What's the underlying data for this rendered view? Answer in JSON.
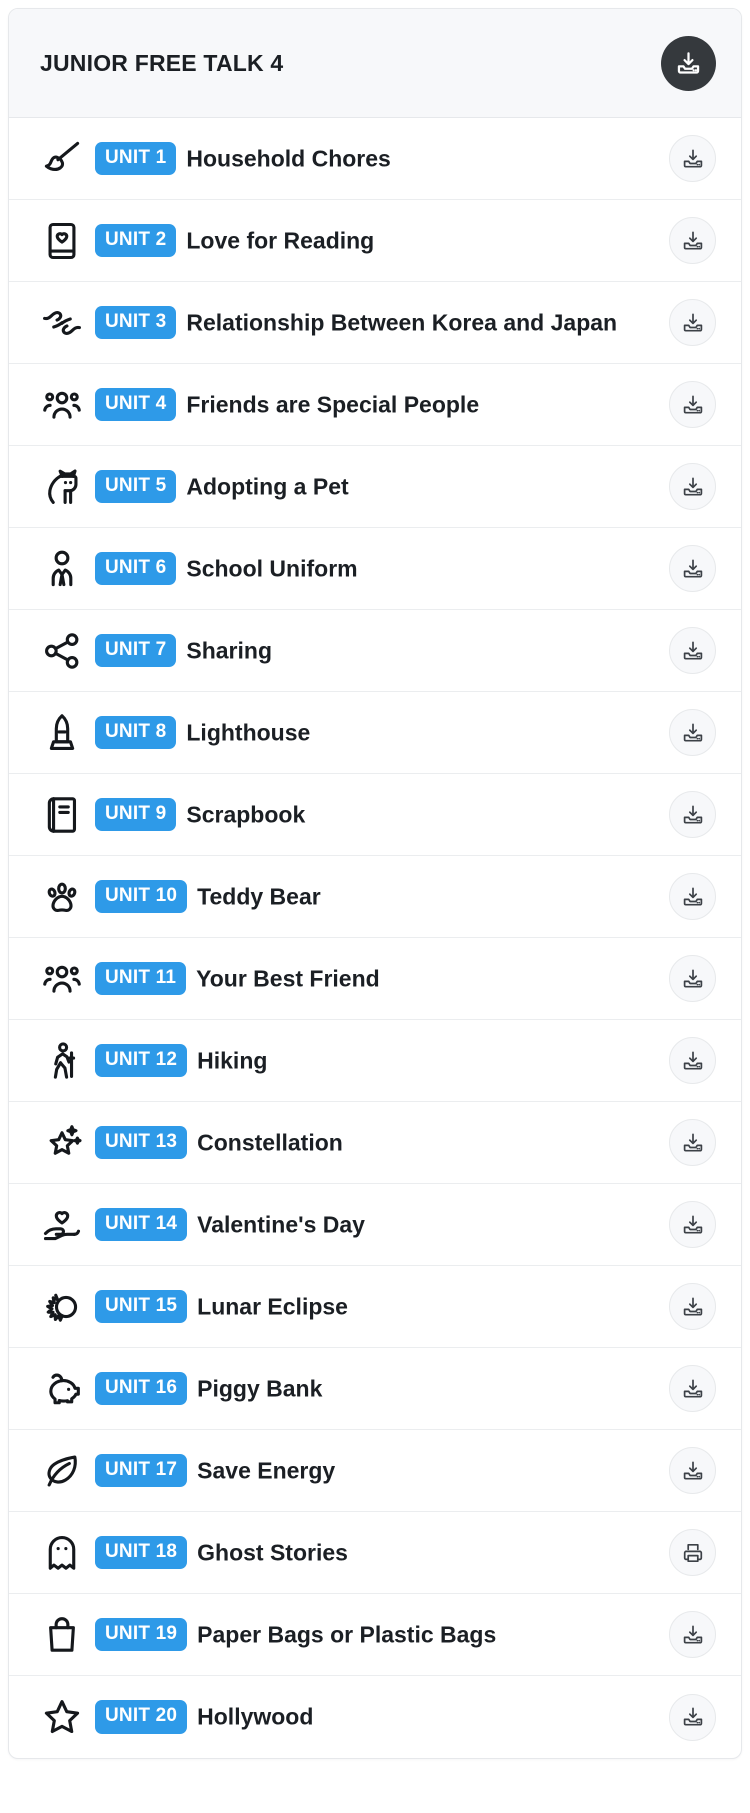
{
  "header": {
    "title": "JUNIOR FREE TALK 4",
    "download_all_icon": "download-icon"
  },
  "colors": {
    "badge_blue": "#2e9ae8",
    "header_bg": "#f7f8fa",
    "header_button_bg": "#35393d",
    "text": "#1b1f24",
    "row_border": "#ebedef"
  },
  "units": [
    {
      "badge": "UNIT 1",
      "title": "Household Chores",
      "icon": "paintbrush-icon",
      "action_icon": "download-icon"
    },
    {
      "badge": "UNIT 2",
      "title": "Love for Reading",
      "icon": "book-heart-icon",
      "action_icon": "download-icon"
    },
    {
      "badge": "UNIT 3",
      "title": "Relationship Between Korea and Japan",
      "icon": "handshake-icon",
      "action_icon": "download-icon"
    },
    {
      "badge": "UNIT 4",
      "title": "Friends are Special People",
      "icon": "people-group-icon",
      "action_icon": "download-icon"
    },
    {
      "badge": "UNIT 5",
      "title": "Adopting a Pet",
      "icon": "cat-icon",
      "action_icon": "download-icon"
    },
    {
      "badge": "UNIT 6",
      "title": "School Uniform",
      "icon": "person-suit-icon",
      "action_icon": "download-icon"
    },
    {
      "badge": "UNIT 7",
      "title": "Sharing",
      "icon": "share-nodes-icon",
      "action_icon": "download-icon"
    },
    {
      "badge": "UNIT 8",
      "title": "Lighthouse",
      "icon": "lighthouse-icon",
      "action_icon": "download-icon"
    },
    {
      "badge": "UNIT 9",
      "title": "Scrapbook",
      "icon": "notebook-icon",
      "action_icon": "download-icon"
    },
    {
      "badge": "UNIT 10",
      "title": "Teddy Bear",
      "icon": "paw-print-icon",
      "action_icon": "download-icon"
    },
    {
      "badge": "UNIT 11",
      "title": "Your Best Friend",
      "icon": "people-group-icon",
      "action_icon": "download-icon"
    },
    {
      "badge": "UNIT 12",
      "title": "Hiking",
      "icon": "hiker-icon",
      "action_icon": "download-icon"
    },
    {
      "badge": "UNIT 13",
      "title": "Constellation",
      "icon": "star-sparkle-icon",
      "action_icon": "download-icon"
    },
    {
      "badge": "UNIT 14",
      "title": "Valentine's Day",
      "icon": "heart-hand-icon",
      "action_icon": "download-icon"
    },
    {
      "badge": "UNIT 15",
      "title": "Lunar Eclipse",
      "icon": "eclipse-icon",
      "action_icon": "download-icon"
    },
    {
      "badge": "UNIT 16",
      "title": "Piggy Bank",
      "icon": "piggy-bank-icon",
      "action_icon": "download-icon"
    },
    {
      "badge": "UNIT 17",
      "title": "Save Energy",
      "icon": "leaf-icon",
      "action_icon": "download-icon"
    },
    {
      "badge": "UNIT 18",
      "title": "Ghost Stories",
      "icon": "ghost-icon",
      "action_icon": "printer-icon"
    },
    {
      "badge": "UNIT 19",
      "title": "Paper Bags or Plastic Bags",
      "icon": "shopping-bag-icon",
      "action_icon": "download-icon"
    },
    {
      "badge": "UNIT 20",
      "title": "Hollywood",
      "icon": "star-icon",
      "action_icon": "download-icon"
    }
  ]
}
